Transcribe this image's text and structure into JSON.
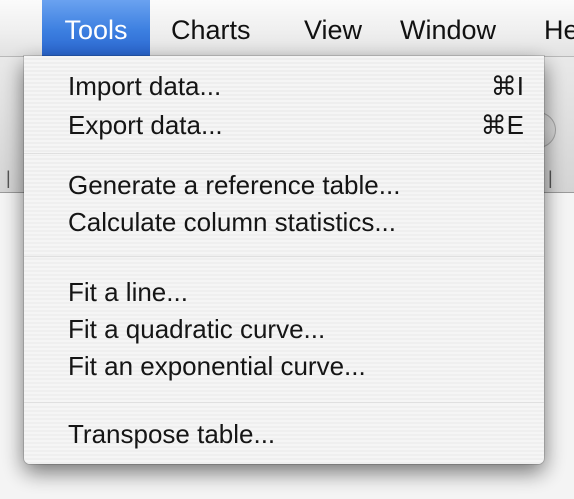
{
  "menubar": {
    "items": [
      {
        "label": "Tools",
        "active": true
      },
      {
        "label": "Charts"
      },
      {
        "label": "View"
      },
      {
        "label": "Window"
      },
      {
        "label": "He"
      }
    ]
  },
  "tools_menu": {
    "groups": [
      {
        "items": [
          {
            "label": "Import data...",
            "shortcut": "⌘I"
          },
          {
            "label": "Export data...",
            "shortcut": "⌘E"
          }
        ]
      },
      {
        "items": [
          {
            "label": "Generate a reference table..."
          },
          {
            "label": "Calculate column statistics..."
          }
        ]
      },
      {
        "items": [
          {
            "label": "Fit a line..."
          },
          {
            "label": "Fit a quadratic curve..."
          },
          {
            "label": "Fit an exponential curve..."
          }
        ]
      },
      {
        "items": [
          {
            "label": "Transpose table..."
          }
        ]
      }
    ]
  },
  "colors": {
    "menu_highlight": "#3c7fe0"
  }
}
